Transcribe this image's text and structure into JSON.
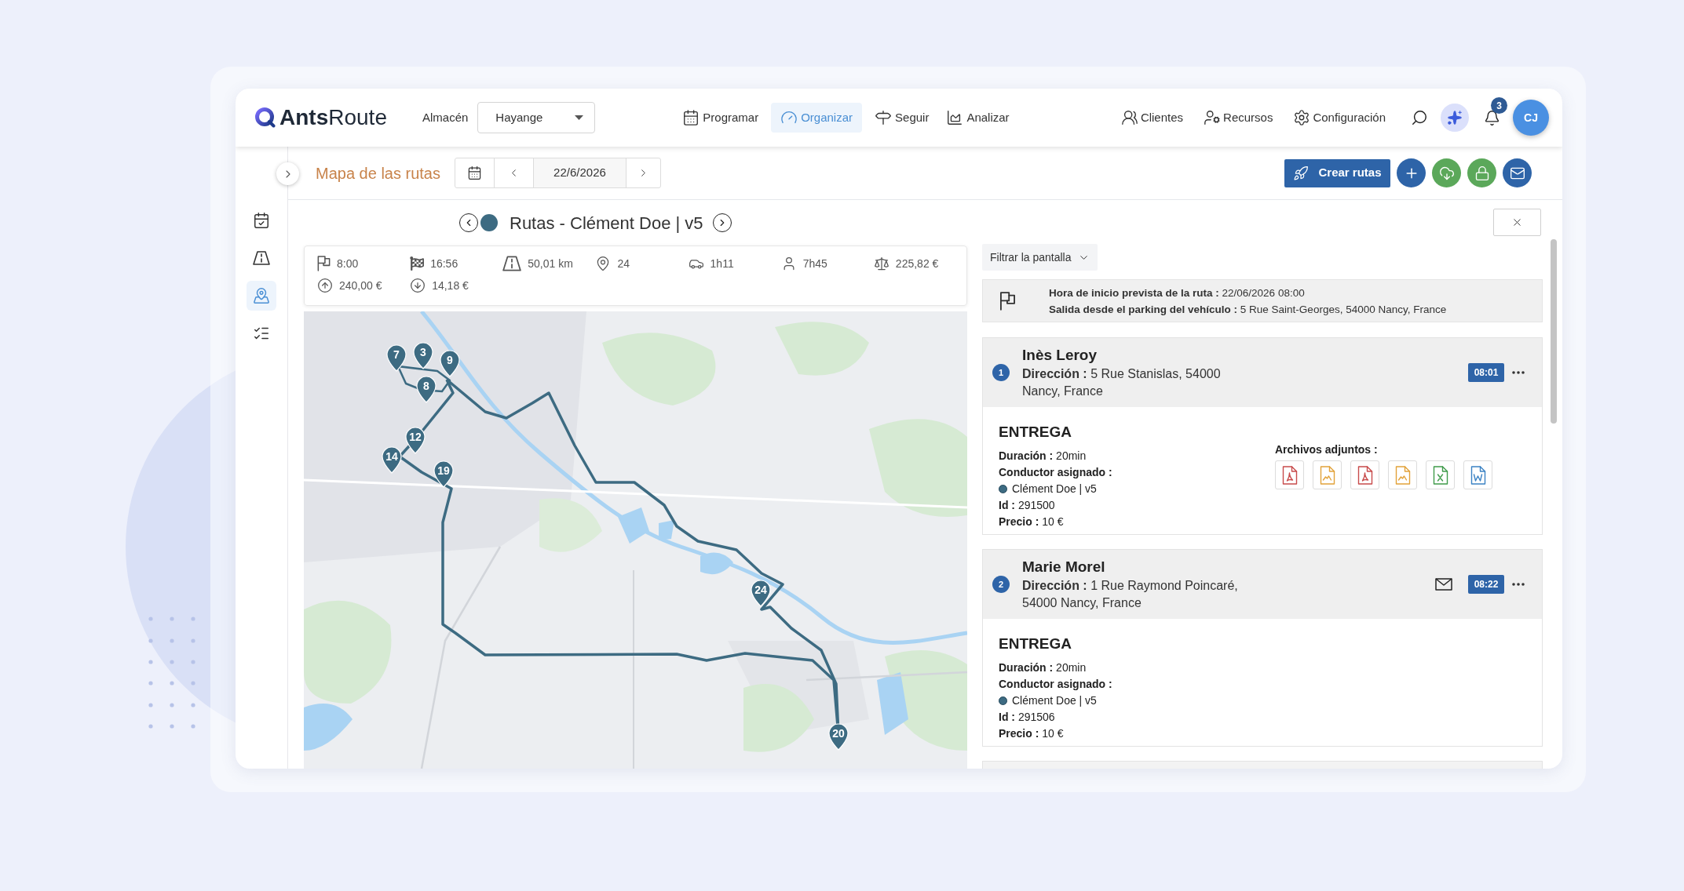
{
  "nav": {
    "logo": "**Ants**Route",
    "warehouse": {
      "label": "Almacén",
      "value": "Hayange"
    },
    "main_menu": [
      {
        "kind": "calendar",
        "label": "Programar",
        "selected": false
      },
      {
        "kind": "gauge",
        "label": "Organizar",
        "selected": true
      },
      {
        "kind": "signpost",
        "label": "Seguir",
        "selected": false
      },
      {
        "kind": "chart",
        "label": "Analizar",
        "selected": false
      }
    ],
    "secondary_menu": [
      {
        "kind": "users",
        "label": "Clientes"
      },
      {
        "kind": "user-gear",
        "label": "Recursos"
      },
      {
        "kind": "gear",
        "label": "Configuración"
      }
    ],
    "notifications": {
      "count": "3"
    },
    "avatar": {
      "initials": "CJ"
    }
  },
  "sidebar": {
    "items": [
      {
        "kind": "calendar-check",
        "selected": false
      },
      {
        "kind": "road",
        "selected": false
      },
      {
        "kind": "map",
        "selected": true
      },
      {
        "kind": "checklist",
        "selected": false
      }
    ]
  },
  "toolbar": {
    "title": "Mapa de las rutas",
    "date": "22/6/2026",
    "create_button": "Crear rutas",
    "actions": [
      {
        "kind": "add"
      },
      {
        "kind": "cloud-download"
      },
      {
        "kind": "lock"
      },
      {
        "kind": "mail"
      }
    ]
  },
  "route": {
    "title": "Rutas - Clément Doe | v5",
    "stats": [
      {
        "kind": "start",
        "value": "8:00"
      },
      {
        "kind": "end",
        "value": "16:56"
      },
      {
        "kind": "distance",
        "value": "50,01 km"
      },
      {
        "kind": "stops",
        "value": "24"
      },
      {
        "kind": "driving",
        "value": "1h11"
      },
      {
        "kind": "work",
        "value": "7h45"
      },
      {
        "kind": "cost",
        "value": "225,82 €"
      },
      {
        "kind": "revenue",
        "value": "240,00 €"
      },
      {
        "kind": "expense",
        "value": "14,18 €"
      }
    ]
  },
  "map": {
    "markers": [
      {
        "label": "7"
      },
      {
        "label": "3"
      },
      {
        "label": "9"
      },
      {
        "label": "8"
      },
      {
        "label": "12"
      },
      {
        "label": "14"
      },
      {
        "label": "19"
      },
      {
        "label": "24"
      },
      {
        "label": "20"
      }
    ]
  },
  "panel": {
    "filter": "Filtrar la pantalla",
    "start_info": [
      "**Hora de inicio prevista de la ruta :** 22/06/2026 08:00",
      "**Salida desde el parking del vehículo :** 5 Rue Saint-Georges, 54000 Nancy, France"
    ],
    "stops": [
      {
        "number": "1",
        "name": "Inès Leroy",
        "address": "**Dirección :** 5 Rue Stanislas, 54000 Nancy, France",
        "email": false,
        "time": "08:01",
        "task": "ENTREGA",
        "details": [
          {
            "kind": "field",
            "text": "**Duración :** 20min"
          },
          {
            "kind": "label",
            "text": "Conductor asignado :"
          },
          {
            "kind": "driver",
            "text": "Clément Doe | v5"
          },
          {
            "kind": "field",
            "text": "**Id :** 291500"
          },
          {
            "kind": "field",
            "text": "**Precio :** 10 €"
          }
        ],
        "attachments": {
          "label": "Archivos adjuntos :",
          "files": [
            {
              "kind": "pdf"
            },
            {
              "kind": "image"
            },
            {
              "kind": "pdf"
            },
            {
              "kind": "image"
            },
            {
              "kind": "spreadsheet"
            },
            {
              "kind": "document"
            }
          ]
        }
      },
      {
        "number": "2",
        "name": "Marie Morel",
        "address": "**Dirección :** 1 Rue Raymond Poincaré, 54000 Nancy, France",
        "email": true,
        "time": "08:22",
        "task": "ENTREGA",
        "details": [
          {
            "kind": "field",
            "text": "**Duración :** 20min"
          },
          {
            "kind": "label",
            "text": "Conductor asignado :"
          },
          {
            "kind": "driver",
            "text": "Clément Doe | v5"
          },
          {
            "kind": "field",
            "text": "**Id :** 291506"
          },
          {
            "kind": "field",
            "text": "**Precio :** 10 €"
          }
        ]
      }
    ]
  }
}
